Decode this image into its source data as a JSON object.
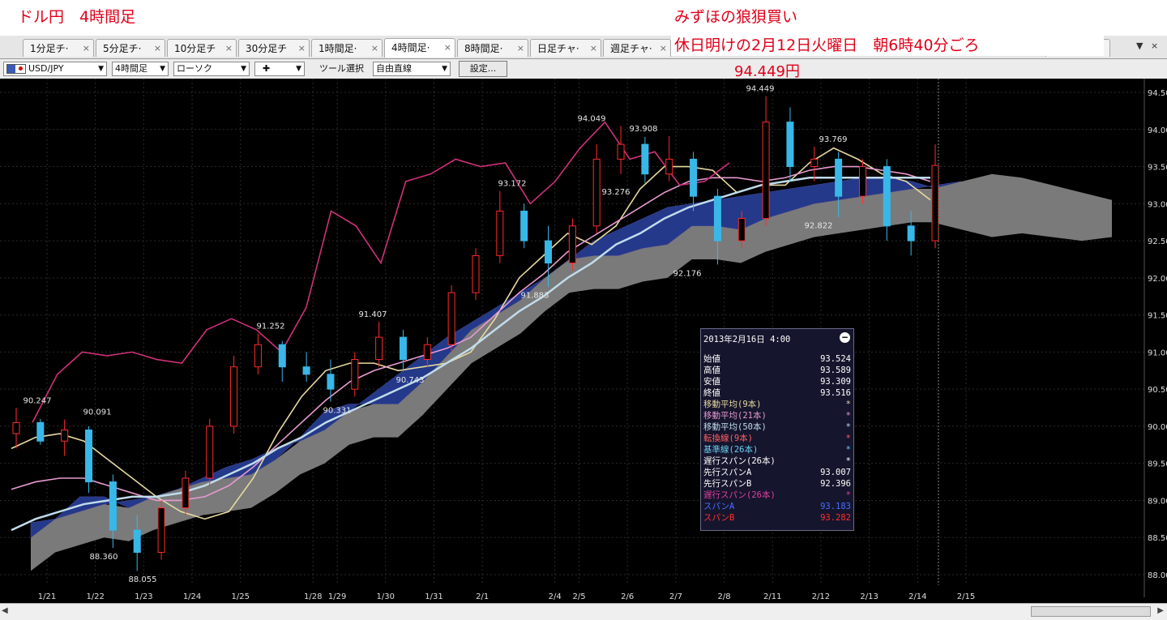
{
  "annotations": {
    "title": "ドル円　4時間足",
    "headline": "みずほの狼狽買い",
    "date_note": "休日明けの2月12日火曜日　朝6時40分ごろ",
    "price_note": "94.449円"
  },
  "tabs": [
    {
      "label": "1分足チ·",
      "active": false
    },
    {
      "label": "5分足チ·",
      "active": false
    },
    {
      "label": "10分足チ",
      "active": false
    },
    {
      "label": "30分足チ",
      "active": false
    },
    {
      "label": "1時間足·",
      "active": false
    },
    {
      "label": "4時間足·",
      "active": true
    },
    {
      "label": "8時間足·",
      "active": false
    },
    {
      "label": "日足チャ·",
      "active": false
    },
    {
      "label": "週足チャ·",
      "active": false
    }
  ],
  "toolbar": {
    "symbol": "USD/JPY",
    "timeframe": "4時間足",
    "chart_style": "ローソク",
    "cursor": "✚",
    "tool_label": "ツール選択",
    "tool": "自由直線",
    "settings": "設定..."
  },
  "chart_data": {
    "type": "candlestick",
    "ylim": [
      87.8,
      94.8
    ],
    "y_ticks": [
      "94.50",
      "94.00",
      "93.50",
      "93.00",
      "92.50",
      "92.00",
      "91.50",
      "91.00",
      "90.50",
      "90.00",
      "89.50",
      "89.00",
      "88.50",
      "88.00"
    ],
    "x_ticks": [
      "1/21",
      "1/22",
      "1/23",
      "1/24",
      "1/25",
      "1/28",
      "1/29",
      "1/30",
      "1/31",
      "2/1",
      "2/4",
      "2/5",
      "2/6",
      "2/7",
      "2/8",
      "2/11",
      "2/12",
      "2/13",
      "2/14",
      "2/15"
    ],
    "price_labels": [
      "90.247",
      "90.091",
      "88.360",
      "88.055",
      "91.252",
      "91.407",
      "90.331",
      "90.743",
      "93.172",
      "91.883",
      "94.049",
      "93.276",
      "93.908",
      "92.176",
      "94.449",
      "93.769",
      "92.822"
    ],
    "series": [
      {
        "name": "移動平均(9本)",
        "color": "#e8d9a0",
        "values": [
          89.7,
          89.85,
          89.9,
          89.8,
          89.55,
          89.3,
          89.05,
          88.85,
          88.75,
          88.85,
          89.3,
          89.9,
          90.4,
          90.75,
          90.85,
          90.85,
          90.75,
          90.8,
          90.85,
          91.0,
          91.45,
          92.0,
          92.3,
          92.6,
          92.45,
          92.7,
          93.2,
          93.5,
          93.5,
          93.45,
          93.15,
          93.25,
          93.25,
          93.55,
          93.75,
          93.6,
          93.4,
          93.3,
          93.05
        ]
      },
      {
        "name": "移動平均(21本)",
        "color": "#e79ad0",
        "values": [
          89.15,
          89.25,
          89.3,
          89.3,
          89.2,
          89.1,
          89.0,
          89.0,
          89.05,
          89.2,
          89.45,
          89.75,
          90.05,
          90.35,
          90.6,
          90.75,
          90.85,
          90.95,
          91.05,
          91.2,
          91.5,
          91.8,
          92.05,
          92.35,
          92.55,
          92.75,
          92.95,
          93.15,
          93.3,
          93.35,
          93.35,
          93.3,
          93.35,
          93.45,
          93.5,
          93.5,
          93.45,
          93.4,
          93.3
        ]
      },
      {
        "name": "移動平均(50本)",
        "color": "#c0dceb",
        "values": [
          88.6,
          88.75,
          88.85,
          88.95,
          89.0,
          89.05,
          89.05,
          89.1,
          89.2,
          89.35,
          89.5,
          89.7,
          89.85,
          90.05,
          90.2,
          90.35,
          90.5,
          90.65,
          90.85,
          91.05,
          91.3,
          91.55,
          91.75,
          92.0,
          92.2,
          92.45,
          92.6,
          92.8,
          92.95,
          93.05,
          93.15,
          93.25,
          93.3,
          93.35,
          93.35,
          93.35,
          93.35,
          93.35,
          93.35
        ]
      },
      {
        "name": "遅行スパン(26本)",
        "color": "#d0307a",
        "values": [
          90.05,
          90.7,
          91.0,
          90.95,
          91.0,
          90.9,
          90.85,
          91.3,
          91.45,
          91.3,
          91.0,
          91.6,
          92.9,
          92.7,
          92.2,
          93.3,
          93.4,
          93.6,
          93.5,
          93.55,
          93.0,
          93.3,
          93.75,
          94.1,
          93.6,
          93.7,
          93.25,
          93.3,
          93.55
        ]
      }
    ],
    "ichimoku_cloud": {
      "spanA": [
        88.7,
        88.75,
        88.85,
        88.95,
        89.0,
        89.05,
        89.15,
        89.3,
        89.45,
        89.55,
        89.7,
        89.8,
        89.95,
        90.2,
        90.45,
        90.7,
        90.95,
        91.2,
        91.4,
        91.6,
        91.8,
        92.0,
        92.25,
        92.5,
        92.65,
        92.8,
        92.95,
        93.0,
        93.05,
        93.1,
        93.15,
        93.2,
        93.25,
        93.3,
        93.35,
        93.35,
        93.3,
        93.2,
        93.2
      ],
      "spanB": [
        88.5,
        88.75,
        89.05,
        89.05,
        88.9,
        89.05,
        89.15,
        89.25,
        89.3,
        89.35,
        89.55,
        89.85,
        90.2,
        90.3,
        90.3,
        90.3,
        90.6,
        90.95,
        91.3,
        91.5,
        91.7,
        92.0,
        92.25,
        92.3,
        92.3,
        92.4,
        92.45,
        92.7,
        92.7,
        92.65,
        92.8,
        92.9,
        93.0,
        93.05,
        93.1,
        93.15,
        93.2,
        93.25,
        93.3
      ],
      "futureA": [
        93.2,
        93.3,
        93.4,
        93.35,
        93.25,
        93.15,
        93.05
      ],
      "futureB": [
        92.75,
        92.65,
        92.55,
        92.6,
        92.55,
        92.5,
        92.55
      ]
    },
    "candles": [
      {
        "x": "1/21",
        "o": 89.9,
        "h": 90.25,
        "l": 89.7,
        "c": 90.05
      },
      {
        "x": "",
        "o": 90.05,
        "h": 90.1,
        "l": 89.75,
        "c": 89.8
      },
      {
        "x": "1/22",
        "o": 89.8,
        "h": 90.09,
        "l": 89.6,
        "c": 89.95
      },
      {
        "x": "",
        "o": 89.95,
        "h": 90.0,
        "l": 89.1,
        "c": 89.25
      },
      {
        "x": "1/23",
        "o": 89.25,
        "h": 89.35,
        "l": 88.36,
        "c": 88.6
      },
      {
        "x": "",
        "o": 88.6,
        "h": 88.8,
        "l": 88.05,
        "c": 88.3
      },
      {
        "x": "1/24",
        "o": 88.3,
        "h": 89.0,
        "l": 88.2,
        "c": 88.9
      },
      {
        "x": "",
        "o": 88.9,
        "h": 89.4,
        "l": 88.8,
        "c": 89.3
      },
      {
        "x": "1/25",
        "o": 89.3,
        "h": 90.1,
        "l": 89.2,
        "c": 90.0
      },
      {
        "x": "",
        "o": 90.0,
        "h": 90.95,
        "l": 89.9,
        "c": 90.8
      },
      {
        "x": "",
        "o": 90.8,
        "h": 91.25,
        "l": 90.7,
        "c": 91.1
      },
      {
        "x": "1/28",
        "o": 91.1,
        "h": 91.15,
        "l": 90.6,
        "c": 90.8
      },
      {
        "x": "1/29",
        "o": 90.8,
        "h": 91.0,
        "l": 90.6,
        "c": 90.7
      },
      {
        "x": "",
        "o": 90.7,
        "h": 90.9,
        "l": 90.33,
        "c": 90.5
      },
      {
        "x": "1/30",
        "o": 90.5,
        "h": 91.0,
        "l": 90.4,
        "c": 90.9
      },
      {
        "x": "",
        "o": 90.9,
        "h": 91.41,
        "l": 90.8,
        "c": 91.2
      },
      {
        "x": "1/31",
        "o": 91.2,
        "h": 91.3,
        "l": 90.74,
        "c": 90.9
      },
      {
        "x": "",
        "o": 90.9,
        "h": 91.2,
        "l": 90.8,
        "c": 91.1
      },
      {
        "x": "2/1",
        "o": 91.1,
        "h": 91.9,
        "l": 91.0,
        "c": 91.8
      },
      {
        "x": "",
        "o": 91.8,
        "h": 92.4,
        "l": 91.7,
        "c": 92.3
      },
      {
        "x": "",
        "o": 92.3,
        "h": 93.17,
        "l": 92.2,
        "c": 92.9
      },
      {
        "x": "2/4",
        "o": 92.9,
        "h": 93.0,
        "l": 92.4,
        "c": 92.5
      },
      {
        "x": "2/5",
        "o": 92.5,
        "h": 92.7,
        "l": 91.88,
        "c": 92.2
      },
      {
        "x": "",
        "o": 92.2,
        "h": 92.8,
        "l": 92.1,
        "c": 92.7
      },
      {
        "x": "2/6",
        "o": 92.7,
        "h": 93.8,
        "l": 92.6,
        "c": 93.6
      },
      {
        "x": "",
        "o": 93.6,
        "h": 94.05,
        "l": 93.4,
        "c": 93.8
      },
      {
        "x": "2/7",
        "o": 93.8,
        "h": 93.9,
        "l": 93.28,
        "c": 93.4
      },
      {
        "x": "",
        "o": 93.4,
        "h": 93.91,
        "l": 93.3,
        "c": 93.6
      },
      {
        "x": "2/8",
        "o": 93.6,
        "h": 93.7,
        "l": 92.9,
        "c": 93.1
      },
      {
        "x": "",
        "o": 93.1,
        "h": 93.2,
        "l": 92.18,
        "c": 92.5
      },
      {
        "x": "2/11",
        "o": 92.5,
        "h": 92.9,
        "l": 92.4,
        "c": 92.8
      },
      {
        "x": "",
        "o": 92.8,
        "h": 94.45,
        "l": 92.7,
        "c": 94.1
      },
      {
        "x": "2/12",
        "o": 94.1,
        "h": 94.3,
        "l": 93.3,
        "c": 93.5
      },
      {
        "x": "",
        "o": 93.5,
        "h": 93.77,
        "l": 93.3,
        "c": 93.6
      },
      {
        "x": "2/13",
        "o": 93.6,
        "h": 93.7,
        "l": 92.82,
        "c": 93.1
      },
      {
        "x": "",
        "o": 93.1,
        "h": 93.6,
        "l": 93.0,
        "c": 93.5
      },
      {
        "x": "2/14",
        "o": 93.5,
        "h": 93.6,
        "l": 92.5,
        "c": 92.7
      },
      {
        "x": "",
        "o": 92.7,
        "h": 92.9,
        "l": 92.3,
        "c": 92.5
      },
      {
        "x": "2/15",
        "o": 92.5,
        "h": 93.8,
        "l": 92.4,
        "c": 93.516
      }
    ]
  },
  "infobox": {
    "title": "2013年2月16日  4:00",
    "rows": [
      {
        "name": "始値",
        "value": "93.524",
        "color": "#ffffff"
      },
      {
        "name": "高値",
        "value": "93.589",
        "color": "#ffffff"
      },
      {
        "name": "安値",
        "value": "93.309",
        "color": "#ffffff"
      },
      {
        "name": "終値",
        "value": "93.516",
        "color": "#ffffff"
      },
      {
        "name": "移動平均(9本)",
        "value": "*",
        "color": "#e8d9a0"
      },
      {
        "name": "移動平均(21本)",
        "value": "*",
        "color": "#e79ad0"
      },
      {
        "name": "移動平均(50本)",
        "value": "*",
        "color": "#c0dceb"
      },
      {
        "name": "転換線(9本)",
        "value": "*",
        "color": "#ff6060"
      },
      {
        "name": "基準線(26本)",
        "value": "*",
        "color": "#6ad0f0"
      },
      {
        "name": "遅行スパン(26本)",
        "value": "*",
        "color": "#ffffff"
      },
      {
        "name": "先行スパンA",
        "value": "93.007",
        "color": "#ffffff"
      },
      {
        "name": "先行スパンB",
        "value": "92.396",
        "color": "#ffffff"
      },
      {
        "name": "遅行スパン(26本)",
        "value": "*",
        "color": "#e040a0"
      },
      {
        "name": "スパンA",
        "value": "93.183",
        "color": "#4a6cff"
      },
      {
        "name": "スパンB",
        "value": "93.282",
        "color": "#ff3030"
      }
    ]
  }
}
